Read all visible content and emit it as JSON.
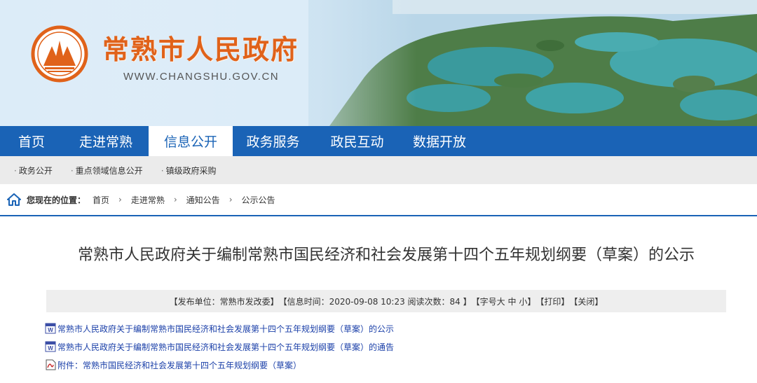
{
  "header": {
    "site_title": "常熟市人民政府",
    "site_domain": "WWW.CHANGSHU.GOV.CN"
  },
  "main_nav": [
    {
      "label": "首页",
      "active": false
    },
    {
      "label": "走进常熟",
      "active": false
    },
    {
      "label": "信息公开",
      "active": true
    },
    {
      "label": "政务服务",
      "active": false
    },
    {
      "label": "政民互动",
      "active": false
    },
    {
      "label": "数据开放",
      "active": false
    }
  ],
  "sub_nav": [
    {
      "label": "政务公开"
    },
    {
      "label": "重点领域信息公开"
    },
    {
      "label": "镇级政府采购"
    }
  ],
  "breadcrumb": {
    "label": "您现在的位置：",
    "items": [
      "首页",
      "走进常熟",
      "通知公告",
      "公示公告"
    ],
    "separator": "›"
  },
  "article": {
    "title": "常熟市人民政府关于编制常熟市国民经济和社会发展第十四个五年规划纲要（草案）的公示",
    "meta": {
      "publisher": "【发布单位：常熟市发改委】",
      "time": "【信息时间：2020-09-08 10:23 阅读次数：84 】",
      "font_size_open": "【字号",
      "font_large": "大",
      "font_medium": "中",
      "font_small": "小",
      "font_size_close": "】",
      "print": "【打印】",
      "close": "【关闭】"
    },
    "attachments": [
      {
        "text": "常熟市人民政府关于编制常熟市国民经济和社会发展第十四个五年规划纲要（草案）的公示",
        "icon": "doc-icon"
      },
      {
        "text": "常熟市人民政府关于编制常熟市国民经济和社会发展第十四个五年规划纲要（草案）的通告",
        "icon": "doc-icon"
      },
      {
        "text": "附件：常熟市国民经济和社会发展第十四个五年规划纲要（草案）",
        "icon": "pdf-icon"
      }
    ]
  },
  "colors": {
    "nav_blue": "#1a63b6",
    "title_orange": "#e0621a",
    "link_blue": "#1a3fa8"
  }
}
